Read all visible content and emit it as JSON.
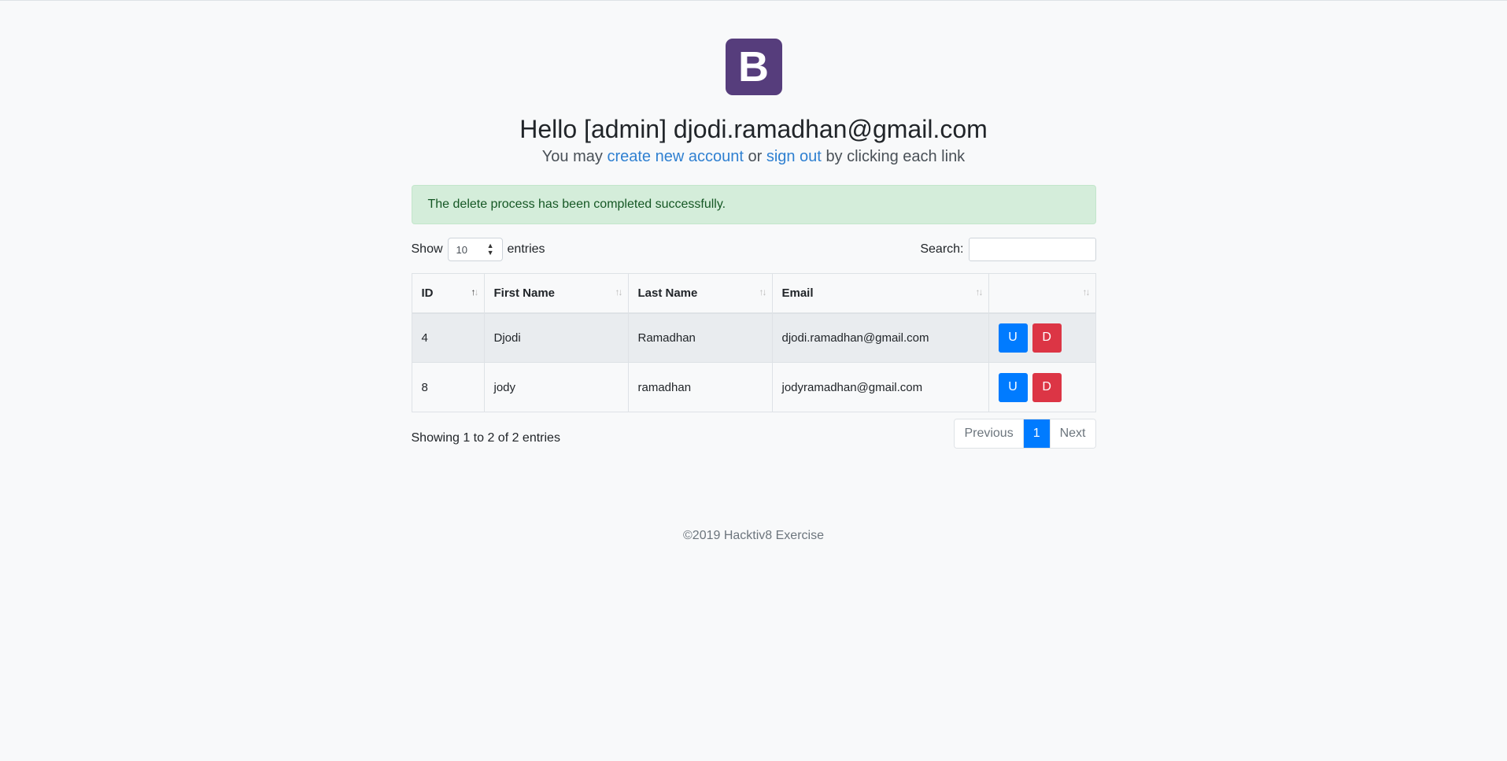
{
  "logo": {
    "letter": "B",
    "color": "#563d7c"
  },
  "header": {
    "greeting": "Hello [admin] djodi.ramadhan@gmail.com",
    "lead_prefix": "You may",
    "create_link": "create new account",
    "lead_or": "or",
    "signout_link": "sign out",
    "lead_suffix": "by clicking each link"
  },
  "alert": {
    "text": "The delete process has been completed successfully."
  },
  "controls": {
    "show_label": "Show",
    "page_size": "10",
    "entries_label": "entries",
    "search_label": "Search:",
    "search_value": ""
  },
  "table": {
    "columns": [
      "ID",
      "First Name",
      "Last Name",
      "Email",
      ""
    ],
    "rows": [
      {
        "id": "4",
        "first": "Djodi",
        "last": "Ramadhan",
        "email": "djodi.ramadhan@gmail.com",
        "update": "U",
        "delete": "D"
      },
      {
        "id": "8",
        "first": "jody",
        "last": "ramadhan",
        "email": "jodyramadhan@gmail.com",
        "update": "U",
        "delete": "D"
      }
    ]
  },
  "pagination": {
    "info": "Showing 1 to 2 of 2 entries",
    "previous": "Previous",
    "current": "1",
    "next": "Next"
  },
  "footer": {
    "copyright": "©2019 Hacktiv8 Exercise"
  },
  "colors": {
    "primary": "#007bff",
    "danger": "#dc3545",
    "success_bg": "#d4edda"
  }
}
